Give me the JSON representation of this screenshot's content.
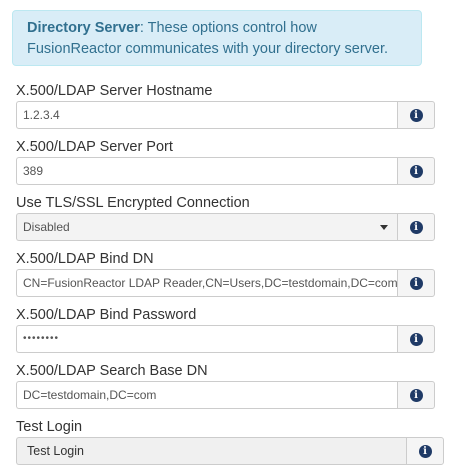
{
  "alert": {
    "bold": "Directory Server",
    "text": ": These options control how FusionReactor communicates with your directory server."
  },
  "fields": {
    "hostname": {
      "label": "X.500/LDAP Server Hostname",
      "value": "1.2.3.4"
    },
    "port": {
      "label": "X.500/LDAP Server Port",
      "value": "389"
    },
    "tls": {
      "label": "Use TLS/SSL Encrypted Connection",
      "value": "Disabled"
    },
    "bind_dn": {
      "label": "X.500/LDAP Bind DN",
      "value": "CN=FusionReactor LDAP Reader,CN=Users,DC=testdomain,DC=com"
    },
    "bind_password": {
      "label": "X.500/LDAP Bind Password",
      "value": "••••••••"
    },
    "search_base": {
      "label": "X.500/LDAP Search Base DN",
      "value": "DC=testdomain,DC=com"
    },
    "test_login": {
      "label": "Test Login",
      "button": "Test Login"
    }
  },
  "icons": {
    "info": "i"
  }
}
